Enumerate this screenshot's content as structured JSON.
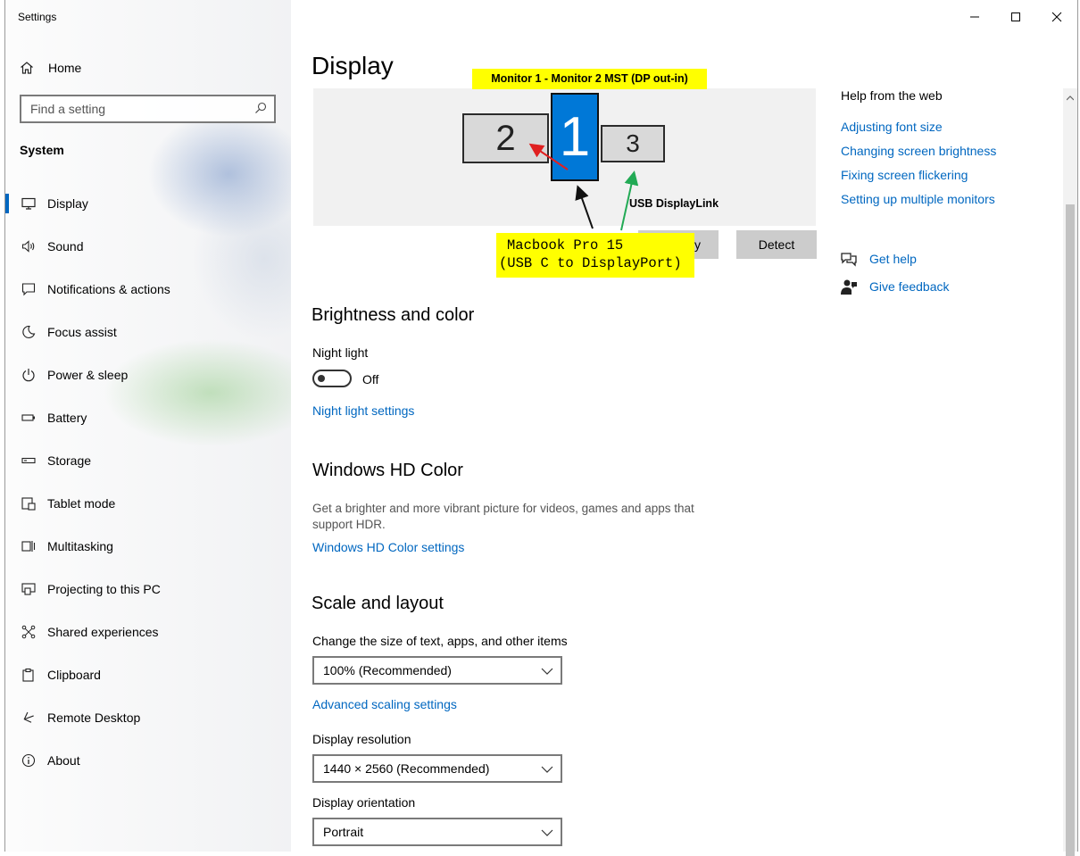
{
  "window": {
    "title": "Settings",
    "controls": {
      "minimize": "—",
      "maximize": "☐",
      "close": "✕"
    }
  },
  "sidebar": {
    "home": {
      "label": "Home",
      "icon": "home-icon"
    },
    "search": {
      "placeholder": "Find a setting",
      "icon": "search-icon"
    },
    "section_label": "System",
    "items": [
      {
        "label": "Display",
        "icon": "monitor-icon",
        "active": true
      },
      {
        "label": "Sound",
        "icon": "speaker-icon"
      },
      {
        "label": "Notifications & actions",
        "icon": "notification-icon"
      },
      {
        "label": "Focus assist",
        "icon": "moon-icon"
      },
      {
        "label": "Power & sleep",
        "icon": "power-icon"
      },
      {
        "label": "Battery",
        "icon": "battery-icon"
      },
      {
        "label": "Storage",
        "icon": "storage-icon"
      },
      {
        "label": "Tablet mode",
        "icon": "tablet-icon"
      },
      {
        "label": "Multitasking",
        "icon": "multitasking-icon"
      },
      {
        "label": "Projecting to this PC",
        "icon": "projector-icon"
      },
      {
        "label": "Shared experiences",
        "icon": "share-icon"
      },
      {
        "label": "Clipboard",
        "icon": "clipboard-icon"
      },
      {
        "label": "Remote Desktop",
        "icon": "remote-icon"
      },
      {
        "label": "About",
        "icon": "info-icon"
      }
    ]
  },
  "main": {
    "title": "Display",
    "display_arrangement": {
      "monitors": [
        {
          "number": "2",
          "selected": false
        },
        {
          "number": "1",
          "selected": true
        },
        {
          "number": "3",
          "selected": false
        }
      ],
      "identify_label": "fy",
      "detect_label": "Detect"
    },
    "annotations": {
      "top": "Monitor 1 - Monitor 2 MST (DP out-in)",
      "displaylink": "USB DisplayLink",
      "macbook_line1": "Macbook Pro 15",
      "macbook_line2": "(USB C  to DisplayPort)"
    },
    "brightness": {
      "heading": "Brightness and color",
      "night_light_label": "Night light",
      "night_light_state": "Off",
      "night_light_settings_link": "Night light settings"
    },
    "hd_color": {
      "heading": "Windows HD Color",
      "description_line1": "Get a brighter and more vibrant picture for videos, games and apps that",
      "description_line2": "support HDR.",
      "settings_link": "Windows HD Color settings"
    },
    "scale_layout": {
      "heading": "Scale and layout",
      "scale_label": "Change the size of text, apps, and other items",
      "scale_value": "100% (Recommended)",
      "advanced_link": "Advanced scaling settings",
      "resolution_label": "Display resolution",
      "resolution_value": "1440 × 2560 (Recommended)",
      "orientation_label": "Display orientation",
      "orientation_value": "Portrait"
    }
  },
  "help": {
    "heading": "Help from the web",
    "links": [
      "Adjusting font size",
      "Changing screen brightness",
      "Fixing screen flickering",
      "Setting up multiple monitors"
    ],
    "get_help": "Get help",
    "give_feedback": "Give feedback"
  },
  "colors": {
    "accent": "#0067c0",
    "selected_monitor": "#0078d7",
    "callout": "#ffff00",
    "red_arrow": "#e02020",
    "green_arrow": "#22aa55"
  }
}
